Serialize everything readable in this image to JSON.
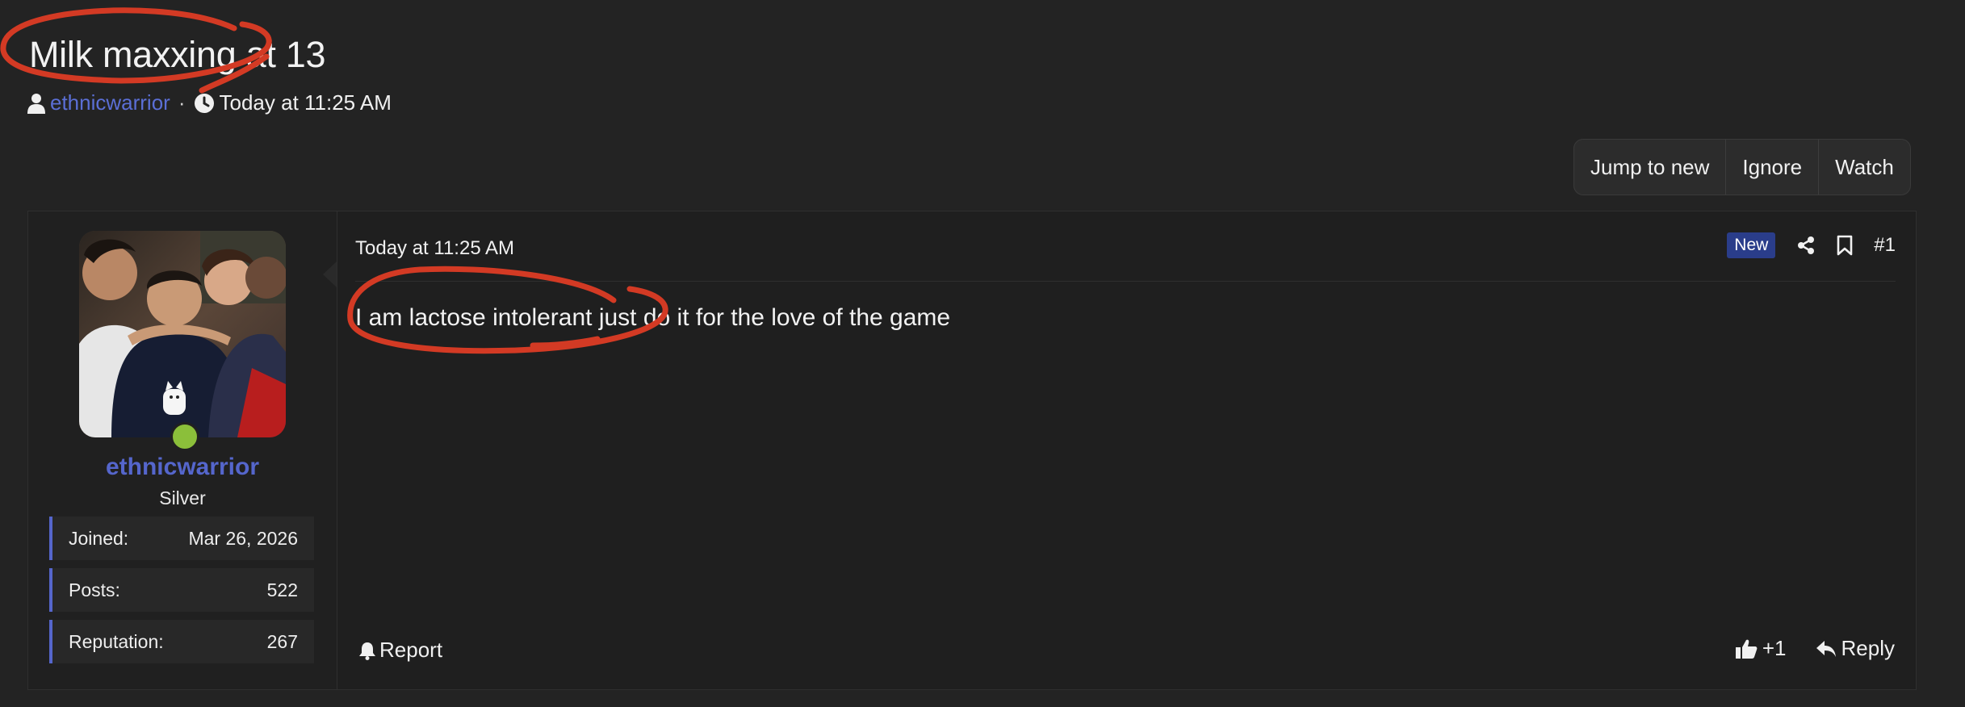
{
  "thread": {
    "title": "Milk maxxing at 13",
    "author": "ethnicwarrior",
    "separator": "·",
    "date": "Today at 11:25 AM"
  },
  "actions": {
    "jump_to_new": "Jump to new",
    "ignore": "Ignore",
    "watch": "Watch"
  },
  "post": {
    "user": {
      "name": "ethnicwarrior",
      "rank": "Silver",
      "stats": [
        {
          "label": "Joined:",
          "value": "Mar 26, 2026"
        },
        {
          "label": "Posts:",
          "value": "522"
        },
        {
          "label": "Reputation:",
          "value": "267"
        }
      ],
      "status_color": "#8bbf3a"
    },
    "date": "Today at 11:25 AM",
    "new_badge": "New",
    "number": "#1",
    "body": "I am lactose intolerant just do it for the love of the game",
    "report_label": "Report",
    "reaction_label": "+1",
    "reply_label": "Reply"
  },
  "icons": [
    "user-icon",
    "clock-icon",
    "share-icon",
    "bookmark-icon",
    "bell-icon",
    "thumbs-up-icon",
    "reply-icon"
  ],
  "colors": {
    "background": "#232323",
    "accent": "#5566cc",
    "annotation": "#d33a24",
    "new_badge": "#2a3d8a"
  }
}
